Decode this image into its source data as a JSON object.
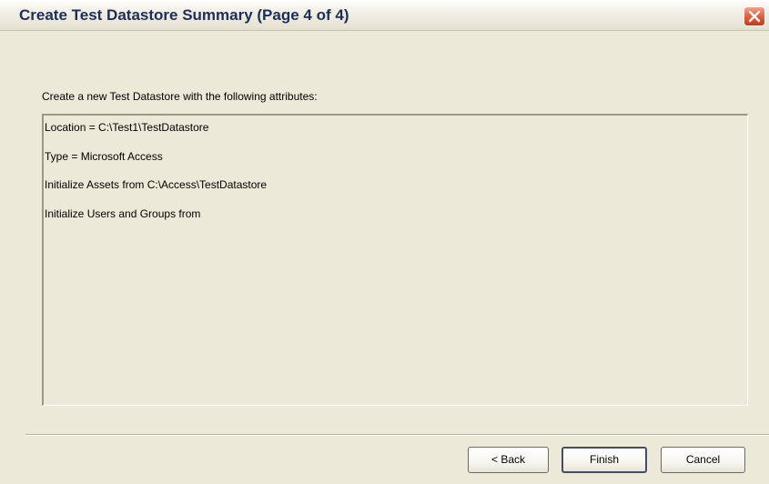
{
  "window": {
    "title": "Create Test Datastore Summary (Page 4 of 4)"
  },
  "icons": {
    "close": "close-icon"
  },
  "summary": {
    "intro": "Create a new Test Datastore with the following attributes:",
    "lines": [
      "Location = C:\\Test1\\TestDatastore",
      "Type = Microsoft Access",
      "Initialize Assets from C:\\Access\\TestDatastore",
      "Initialize Users and Groups from"
    ]
  },
  "buttons": {
    "back": "< Back",
    "finish": "Finish",
    "cancel": "Cancel"
  },
  "colors": {
    "dialog_background": "#ece9d8",
    "title_text": "#1b2f5a",
    "close_button": "#e36546"
  }
}
